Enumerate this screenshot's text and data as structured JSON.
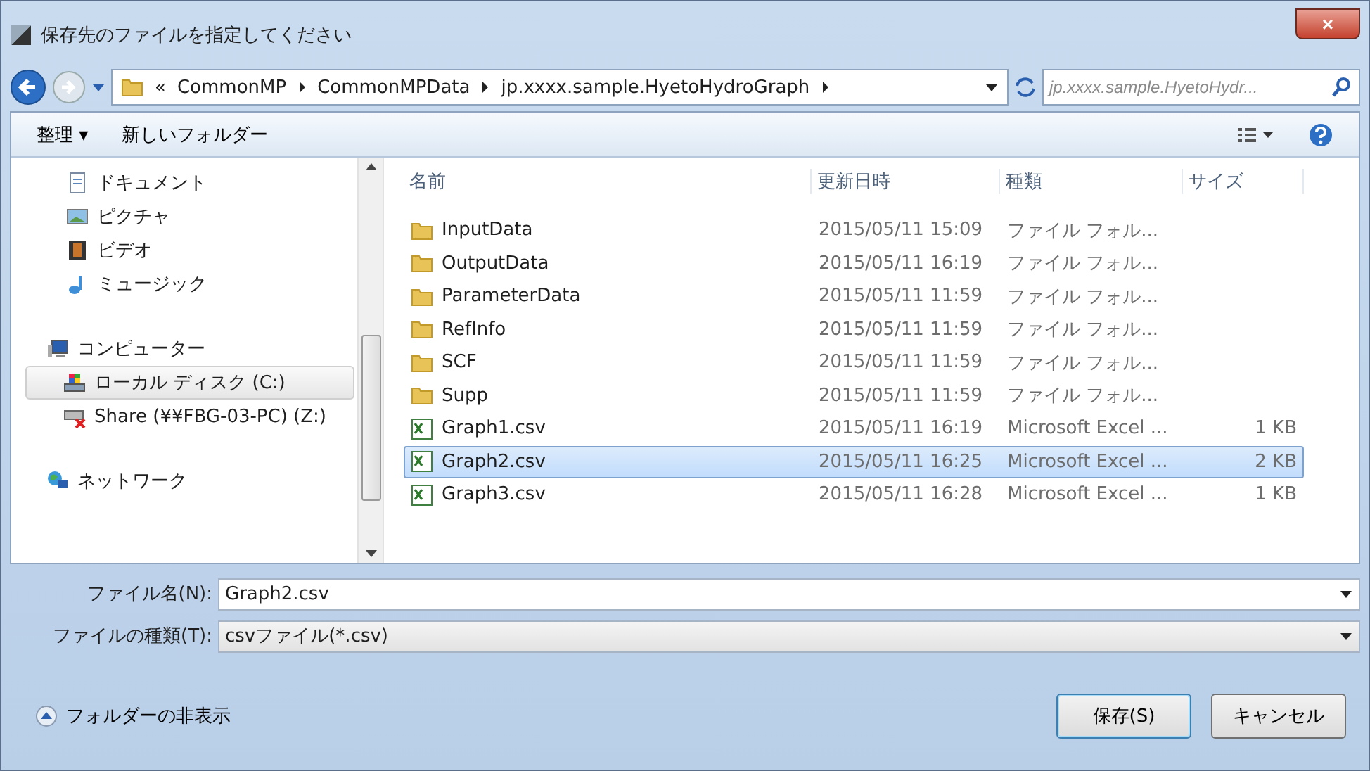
{
  "window": {
    "title": "保存先のファイルを指定してください",
    "close": "×"
  },
  "address": {
    "crumbs": [
      "CommonMP",
      "CommonMPData",
      "jp.xxxx.sample.HyetoHydroGraph"
    ],
    "overflow": "«",
    "search_placeholder": "jp.xxxx.sample.HyetoHydr..."
  },
  "toolbar": {
    "organize": "整理 ▾",
    "new_folder": "新しいフォルダー"
  },
  "sidebar": {
    "groups": [
      {
        "items": [
          {
            "label": "ドキュメント",
            "kind": "document",
            "selected": false
          },
          {
            "label": "ピクチャ",
            "kind": "picture",
            "selected": false
          },
          {
            "label": "ビデオ",
            "kind": "video",
            "selected": false
          },
          {
            "label": "ミュージック",
            "kind": "music",
            "selected": false
          }
        ]
      },
      {
        "items": [
          {
            "label": "コンピューター",
            "kind": "computer",
            "selected": false,
            "children": [
              {
                "label": "ローカル ディスク (C:)",
                "kind": "drive",
                "selected": true
              },
              {
                "label": "Share (¥¥FBG-03-PC) (Z:)",
                "kind": "netdrive",
                "selected": false
              }
            ]
          }
        ]
      },
      {
        "items": [
          {
            "label": "ネットワーク",
            "kind": "network",
            "selected": false
          }
        ]
      }
    ]
  },
  "table": {
    "columns": [
      "名前",
      "更新日時",
      "種類",
      "サイズ"
    ],
    "rows": [
      {
        "kind": "folder",
        "name": "InputData",
        "date": "2015/05/11 15:09",
        "type": "ファイル フォル...",
        "selected": false
      },
      {
        "kind": "folder",
        "name": "OutputData",
        "date": "2015/05/11 16:19",
        "type": "ファイル フォル...",
        "selected": false
      },
      {
        "kind": "folder",
        "name": "ParameterData",
        "date": "2015/05/11 11:59",
        "type": "ファイル フォル...",
        "selected": false
      },
      {
        "kind": "folder",
        "name": "RefInfo",
        "date": "2015/05/11 11:59",
        "type": "ファイル フォル...",
        "selected": false
      },
      {
        "kind": "folder",
        "name": "SCF",
        "date": "2015/05/11 11:59",
        "type": "ファイル フォル...",
        "selected": false
      },
      {
        "kind": "folder",
        "name": "Supp",
        "date": "2015/05/11 11:59",
        "type": "ファイル フォル...",
        "selected": false
      },
      {
        "kind": "excel",
        "name": "Graph1.csv",
        "date": "2015/05/11 16:19",
        "type": "Microsoft Excel ...",
        "size": "1 KB",
        "selected": false
      },
      {
        "kind": "excel",
        "name": "Graph2.csv",
        "date": "2015/05/11 16:25",
        "type": "Microsoft Excel ...",
        "size": "2 KB",
        "selected": true
      },
      {
        "kind": "excel",
        "name": "Graph3.csv",
        "date": "2015/05/11 16:28",
        "type": "Microsoft Excel ...",
        "size": "1 KB",
        "selected": false
      }
    ]
  },
  "form": {
    "filename_label": "ファイル名(N):",
    "filename": "Graph2.csv",
    "filetype_label": "ファイルの種類(T):",
    "filetype": "csvファイル(*.csv)"
  },
  "footer": {
    "hide_folders": "フォルダーの非表示",
    "save": "保存(S)",
    "cancel": "キャンセル"
  }
}
